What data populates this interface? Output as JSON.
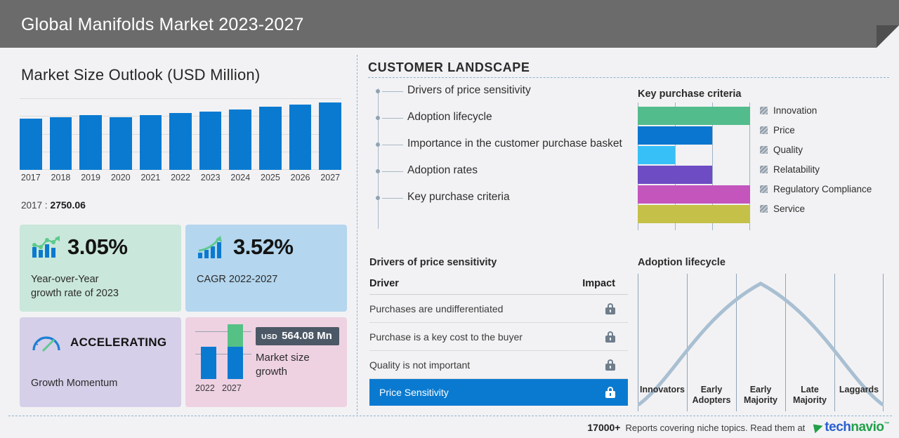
{
  "header": {
    "title": "Global Manifolds Market 2023-2027"
  },
  "left": {
    "market_title": "Market Size Outlook (USD Million)",
    "value_label": "2017 :",
    "value_number": "2750.06",
    "cards": {
      "yoy": {
        "value": "3.05%",
        "sub_line1": "Year-over-Year",
        "sub_line2": "growth rate of 2023",
        "bg": "#c9e7da"
      },
      "cagr": {
        "value": "3.52%",
        "sub": "CAGR  2022-2027",
        "bg": "#b4d6ee"
      },
      "momentum": {
        "value": "ACCELERATING",
        "sub": "Growth Momentum",
        "bg": "#d5cfe9"
      },
      "growth": {
        "currency": "USD",
        "amount": "564.08 Mn",
        "text_line1": "Market size",
        "text_line2": "growth",
        "year_start": "2022",
        "year_end": "2027",
        "bg": "#eed2e2"
      }
    }
  },
  "customer_landscape": {
    "title": "CUSTOMER LANDSCAPE",
    "items": [
      {
        "label": "Drivers of price sensitivity"
      },
      {
        "label": "Adoption lifecycle"
      },
      {
        "label": "Importance in the customer purchase basket"
      },
      {
        "label": "Adoption rates"
      },
      {
        "label": "Key purchase criteria"
      }
    ]
  },
  "drivers": {
    "title": "Drivers of price sensitivity",
    "col_driver": "Driver",
    "col_impact": "Impact",
    "rows": [
      {
        "driver": "Purchases are undifferentiated",
        "impact": "locked",
        "highlight": false
      },
      {
        "driver": "Purchase is a key cost to the buyer",
        "impact": "locked",
        "highlight": false
      },
      {
        "driver": "Quality is not important",
        "impact": "locked",
        "highlight": false
      },
      {
        "driver": "Price Sensitivity",
        "impact": "locked",
        "highlight": true
      }
    ]
  },
  "footer": {
    "count": "17000+",
    "text": "Reports covering niche topics. Read them at",
    "logo_first": "tech",
    "logo_second": "navio"
  },
  "chart_data": [
    {
      "type": "bar",
      "title": "Market Size Outlook (USD Million)",
      "categories": [
        "2017",
        "2018",
        "2019",
        "2020",
        "2021",
        "2022",
        "2023",
        "2024",
        "2025",
        "2026",
        "2027"
      ],
      "values": [
        2750.06,
        2790,
        2820,
        2800,
        2840,
        2890,
        2930,
        2980,
        3040,
        3090,
        3140
      ],
      "bar_heights_pct": [
        72,
        74,
        76,
        74,
        76,
        79,
        81,
        84,
        88,
        91,
        94
      ],
      "xlabel": "",
      "ylabel": "USD Million",
      "grid": true,
      "color": "#0a7ad0"
    },
    {
      "type": "bar",
      "title": "Key purchase criteria",
      "orientation": "horizontal",
      "categories": [
        "Innovation",
        "Price",
        "Quality",
        "Relatability",
        "Regulatory Compliance",
        "Service"
      ],
      "values": [
        3,
        2,
        1,
        2,
        3,
        3
      ],
      "values_pct": [
        100,
        66,
        33,
        66,
        100,
        100
      ],
      "colors": [
        "#52bc8c",
        "#0a76cf",
        "#37c0f7",
        "#6d4cc4",
        "#c355bd",
        "#c5c047"
      ],
      "legend_position": "right",
      "axis_ticks": 3
    },
    {
      "type": "line",
      "title": "Adoption lifecycle",
      "categories": [
        "Innovators",
        "Early Adopters",
        "Early Majority",
        "Late Majority",
        "Laggards"
      ],
      "x": [
        0,
        1,
        2,
        3,
        4,
        5
      ],
      "values": [
        8,
        52,
        96,
        82,
        40,
        2
      ],
      "curve": "bell",
      "color": "#a9bfd2",
      "grid": true
    },
    {
      "type": "bar",
      "title": "Market size growth",
      "categories": [
        "2022",
        "2027"
      ],
      "values": [
        1,
        1.6
      ],
      "series": [
        {
          "name": "base",
          "values": [
            46,
            46
          ],
          "color": "#0a7ad0"
        },
        {
          "name": "growth",
          "values": [
            0,
            32
          ],
          "color": "#56c184"
        }
      ],
      "annotation": "USD 564.08 Mn"
    }
  ],
  "key_purchase_criteria": {
    "title": "Key purchase criteria",
    "items": [
      {
        "label": "Innovation",
        "pct": 100,
        "color": "#52bc8c"
      },
      {
        "label": "Price",
        "pct": 66,
        "color": "#0a76cf"
      },
      {
        "label": "Quality",
        "pct": 33,
        "color": "#37c0f7"
      },
      {
        "label": "Relatability",
        "pct": 66,
        "color": "#6d4cc4"
      },
      {
        "label": "Regulatory Compliance",
        "pct": 100,
        "color": "#c355bd"
      },
      {
        "label": "Service",
        "pct": 100,
        "color": "#c5c047"
      }
    ]
  },
  "adoption_lifecycle": {
    "title": "Adoption lifecycle",
    "stages": [
      {
        "line1": "Innovators",
        "line2": ""
      },
      {
        "line1": "Early",
        "line2": "Adopters"
      },
      {
        "line1": "Early",
        "line2": "Majority"
      },
      {
        "line1": "Late",
        "line2": "Majority"
      },
      {
        "line1": "Laggards",
        "line2": ""
      }
    ]
  }
}
